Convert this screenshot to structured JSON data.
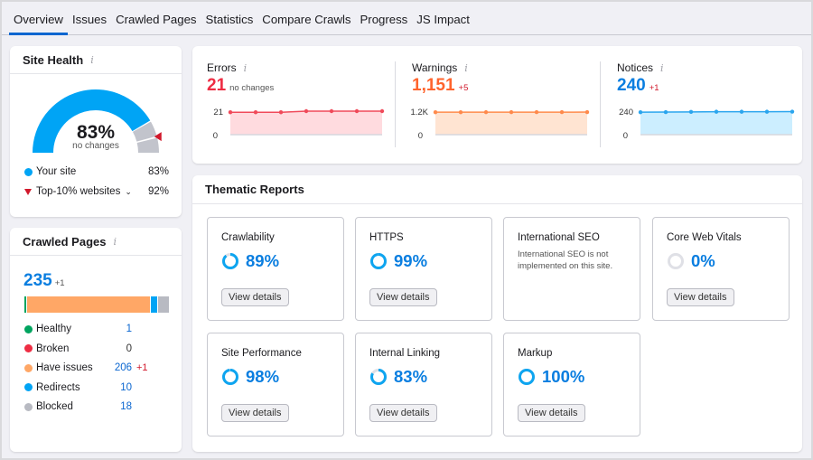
{
  "tabs": [
    {
      "label": "Overview",
      "active": true
    },
    {
      "label": "Issues"
    },
    {
      "label": "Crawled Pages"
    },
    {
      "label": "Statistics"
    },
    {
      "label": "Compare Crawls"
    },
    {
      "label": "Progress"
    },
    {
      "label": "JS Impact"
    }
  ],
  "site_health": {
    "title": "Site Health",
    "info_icon": "i",
    "value": "83%",
    "value_pct": 83,
    "change": "no changes",
    "legend": [
      {
        "label": "Your site",
        "value": "83%",
        "icon": "blue-dot"
      },
      {
        "label": "Top-10% websites",
        "value": "92%",
        "icon": "red-triangle-down",
        "dropdown": true
      }
    ],
    "benchmark_pct": 92,
    "colors": {
      "site": "#00a4f5",
      "rest": "#c2c4cc",
      "marker": "#d1182b"
    }
  },
  "crawled_pages": {
    "title": "Crawled Pages",
    "info_icon": "i",
    "total": "235",
    "total_delta": "+1",
    "rows": [
      {
        "label": "Healthy",
        "value": "1",
        "count": 1,
        "color": "#00a45f",
        "delta": ""
      },
      {
        "label": "Broken",
        "value": "0",
        "count": 0,
        "color": "#ee2d43",
        "delta": ""
      },
      {
        "label": "Have issues",
        "value": "206",
        "count": 206,
        "color": "#ffa766",
        "delta": "+1"
      },
      {
        "label": "Redirects",
        "value": "10",
        "count": 10,
        "color": "#00a4f5",
        "delta": ""
      },
      {
        "label": "Blocked",
        "value": "18",
        "count": 18,
        "color": "#b8bac2",
        "delta": ""
      }
    ]
  },
  "metrics": [
    {
      "title": "Errors",
      "info_icon": "i",
      "value": "21",
      "delta": "no changes",
      "value_color": "#ee2d43",
      "delta_color": "#555555",
      "y_top_label": "21",
      "y_bottom_label": "0",
      "ymax": 21,
      "line_color": "#f04a5a",
      "fill_color": "#ffdbdf",
      "points": [
        20,
        20,
        20,
        21,
        21,
        21,
        21
      ]
    },
    {
      "title": "Warnings",
      "info_icon": "i",
      "value": "1,151",
      "delta": "+5",
      "value_color": "#ff642d",
      "delta_color": "#d1182b",
      "y_top_label": "1.2K",
      "y_bottom_label": "0",
      "ymax": 1200,
      "line_color": "#ff8a4c",
      "fill_color": "#ffe4d2",
      "points": [
        1146,
        1147,
        1148,
        1148,
        1149,
        1150,
        1151
      ]
    },
    {
      "title": "Notices",
      "info_icon": "i",
      "value": "240",
      "delta": "+1",
      "value_color": "#0a7ee0",
      "delta_color": "#d1182b",
      "y_top_label": "240",
      "y_bottom_label": "0",
      "ymax": 245,
      "line_color": "#2aa5ee",
      "fill_color": "#cceeff",
      "points": [
        234,
        235,
        237,
        239,
        239,
        239,
        240
      ]
    }
  ],
  "thematic": {
    "title": "Thematic Reports",
    "button_label": "View details",
    "reports": [
      {
        "name": "Crawlability",
        "value": "89%",
        "pct": 89
      },
      {
        "name": "HTTPS",
        "value": "99%",
        "pct": 99
      },
      {
        "name": "International SEO",
        "description": "International SEO is not implemented on this site."
      },
      {
        "name": "Core Web Vitals",
        "value": "0%",
        "pct": 0
      },
      {
        "name": "Site Performance",
        "value": "98%",
        "pct": 98
      },
      {
        "name": "Internal Linking",
        "value": "83%",
        "pct": 83
      },
      {
        "name": "Markup",
        "value": "100%",
        "pct": 100
      }
    ]
  }
}
